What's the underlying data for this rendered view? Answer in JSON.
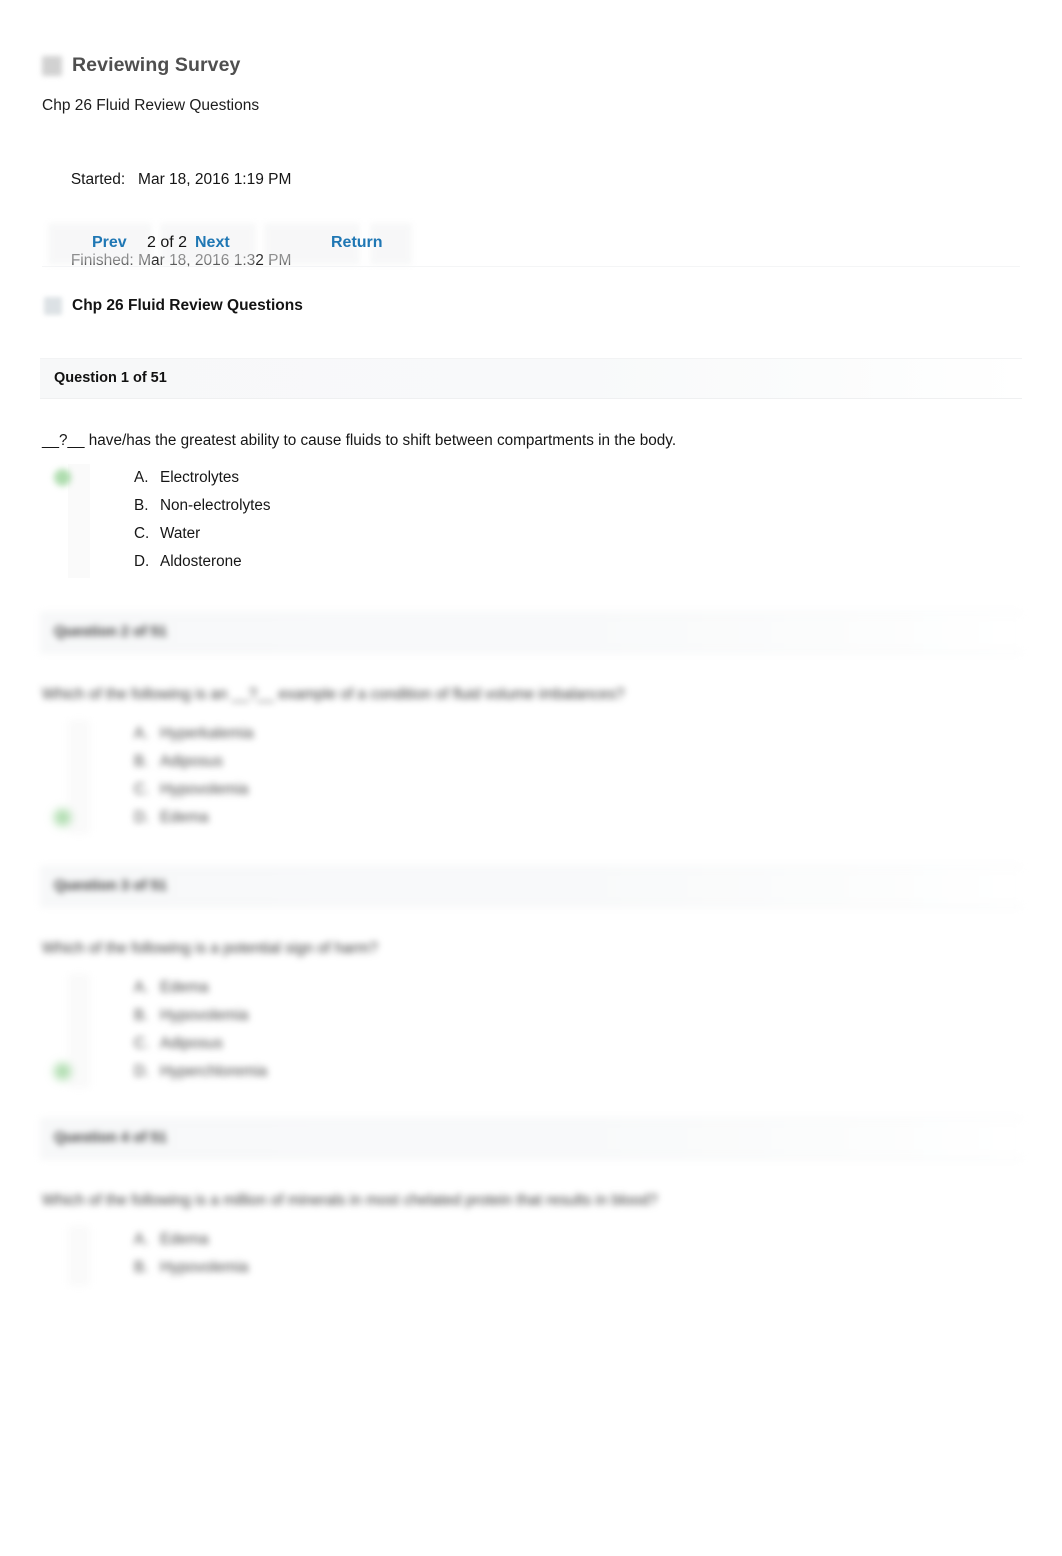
{
  "header": {
    "icon": "survey-icon",
    "title": "Reviewing Survey",
    "survey_name": "Chp 26 Fluid Review Questions"
  },
  "timestamps": {
    "started_label": "Started:",
    "started_value": "Mar 18, 2016 1:19 PM",
    "finished_label": "Finished:",
    "finished_value": "Mar 18, 2016 1:32 PM"
  },
  "navigation": {
    "prev_label": "Prev",
    "page_counter": "2 of 2",
    "next_label": "Next",
    "return_label": "Return"
  },
  "section": {
    "icon": "assessment-icon",
    "title": "Chp 26 Fluid Review Questions"
  },
  "questions": [
    {
      "header": "Question 1 of 51",
      "text": "__?__ have/has the greatest ability to cause fluids to shift between compartments in the body.",
      "options": [
        {
          "letter": "A.",
          "text": "Electrolytes",
          "marked": true
        },
        {
          "letter": "B.",
          "text": "Non-electrolytes",
          "marked": false
        },
        {
          "letter": "C.",
          "text": "Water",
          "marked": false
        },
        {
          "letter": "D.",
          "text": "Aldosterone",
          "marked": false
        }
      ]
    },
    {
      "header": "Question 2 of 51",
      "text": "Which of the following is an __?__ example of a condition of fluid volume imbalances?",
      "options": [
        {
          "letter": "A.",
          "text": "Hyperkalemia",
          "marked": false
        },
        {
          "letter": "B.",
          "text": "Adiposus",
          "marked": false
        },
        {
          "letter": "C.",
          "text": "Hypovolemia",
          "marked": false
        },
        {
          "letter": "D.",
          "text": "Edema",
          "marked": true
        }
      ]
    },
    {
      "header": "Question 3 of 51",
      "text": "Which of the following is a potential sign of harm?",
      "options": [
        {
          "letter": "A.",
          "text": "Edema",
          "marked": false
        },
        {
          "letter": "B.",
          "text": "Hypovolemia",
          "marked": false
        },
        {
          "letter": "C.",
          "text": "Adiposus",
          "marked": false
        },
        {
          "letter": "D.",
          "text": "Hyperchloremia",
          "marked": true
        }
      ]
    },
    {
      "header": "Question 4 of 51",
      "text": "Which of the following is a million of minerals in most chelated protein that results in blood?",
      "options": [
        {
          "letter": "A.",
          "text": "Edema",
          "marked": false
        },
        {
          "letter": "B.",
          "text": "Hypovolemia",
          "marked": false
        }
      ]
    }
  ],
  "colors": {
    "link": "#1f77b4",
    "title": "#4f4f4f",
    "text": "#161616",
    "correct_marker": "#6cc06c",
    "panel_bg": "#f7f8f9"
  }
}
